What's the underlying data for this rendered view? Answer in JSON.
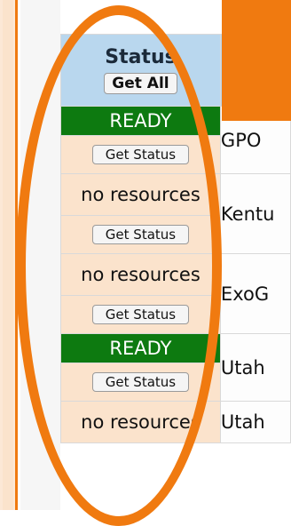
{
  "header": {
    "title": "Status",
    "get_all_label": "Get All"
  },
  "rows": [
    {
      "status": "READY",
      "button": "Get Status",
      "name": "GPO"
    },
    {
      "status": "no resources",
      "button": "Get Status",
      "name": "Kentu"
    },
    {
      "status": "no resources",
      "button": "Get Status",
      "name": "ExoG"
    },
    {
      "status": "READY",
      "button": "Get Status",
      "name": "Utah"
    },
    {
      "status": "no resources",
      "button": "",
      "name": "Utah"
    }
  ],
  "colors": {
    "accent_orange": "#f07a10",
    "ready_green": "#0d7a10",
    "header_blue": "#b9d7ee",
    "row_peach": "#fbe3cc"
  }
}
